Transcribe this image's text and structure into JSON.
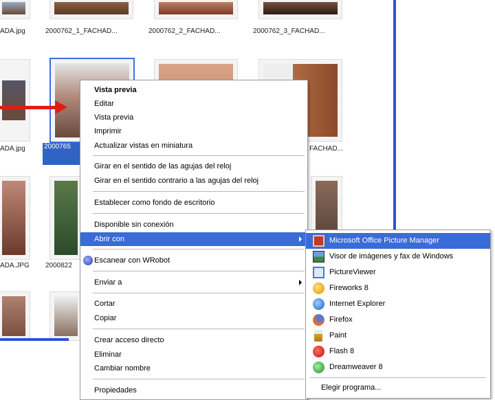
{
  "colors": {
    "selection": "#3a6bd6",
    "arrow": "#e21b12",
    "pane_border": "#2a52d8"
  },
  "thumbnails": {
    "row1_captions": [
      "ADA.jpg",
      "2000762_1_FACHAD...",
      "2000762_2_FACHAD...",
      "2000762_3_FACHAD..."
    ],
    "row2_captions": [
      "ADA.jpg",
      "2000765",
      "FACHAD..."
    ],
    "row3_captions": [
      "ADA.JPG",
      "2000822"
    ]
  },
  "context_menu": {
    "vista_previa_bold": "Vista previa",
    "editar": "Editar",
    "vista_previa": "Vista previa",
    "imprimir": "Imprimir",
    "actualizar": "Actualizar vistas en miniatura",
    "girar_reloj": "Girar en el sentido de las agujas del reloj",
    "girar_contrario": "Girar en el sentido contrario a las agujas del reloj",
    "fondo": "Establecer como fondo de escritorio",
    "sin_conexion": "Disponible sin conexión",
    "abrir_con": "Abrir con",
    "escanear": "Escanear con WRobot",
    "enviar_a": "Enviar a",
    "cortar": "Cortar",
    "copiar": "Copiar",
    "crear_acceso": "Crear acceso directo",
    "eliminar": "Eliminar",
    "cambiar_nombre": "Cambiar nombre",
    "propiedades": "Propiedades"
  },
  "submenu": {
    "items": [
      {
        "label": "Microsoft Office Picture Manager",
        "icon": "picture-manager-icon"
      },
      {
        "label": "Visor de imágenes y fax de Windows",
        "icon": "windows-fax-viewer-icon"
      },
      {
        "label": "PictureViewer",
        "icon": "pictureviewer-icon"
      },
      {
        "label": "Fireworks 8",
        "icon": "fireworks-icon"
      },
      {
        "label": "Internet Explorer",
        "icon": "internet-explorer-icon"
      },
      {
        "label": "Firefox",
        "icon": "firefox-icon"
      },
      {
        "label": "Paint",
        "icon": "paint-icon"
      },
      {
        "label": "Flash 8",
        "icon": "flash-icon"
      },
      {
        "label": "Dreamweaver 8",
        "icon": "dreamweaver-icon"
      }
    ],
    "elegir": "Elegir programa..."
  }
}
